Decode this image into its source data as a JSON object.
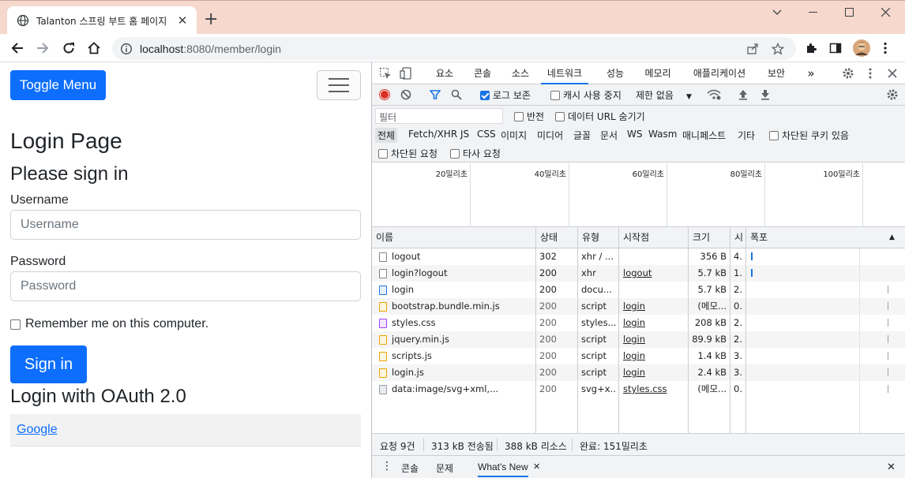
{
  "browser": {
    "tab_title": "Talanton 스프링 부트 홈 페이지",
    "url_host": "localhost",
    "url_rest": ":8080/member/login"
  },
  "page": {
    "toggle_menu": "Toggle Menu",
    "title": "Login Page",
    "subtitle": "Please sign in",
    "username_label": "Username",
    "username_placeholder": "Username",
    "password_label": "Password",
    "password_placeholder": "Password",
    "remember_label": "Remember me on this computer.",
    "signin_label": "Sign in",
    "oauth_heading": "Login with OAuth 2.0",
    "google_link": "Google"
  },
  "devtools": {
    "tabs": [
      "요소",
      "콘솔",
      "소스",
      "네트워크",
      "성능",
      "메모리",
      "애플리케이션",
      "보안"
    ],
    "active_tab": "네트워크",
    "more": "»",
    "toolbar": {
      "preserve_log": "로그 보존",
      "disable_cache": "캐시 사용 중지",
      "throttle": "제한 없음"
    },
    "filter": {
      "placeholder": "필터",
      "invert": "반전",
      "hide_data_urls": "데이터 URL 숨기기",
      "types": [
        "전체",
        "Fetch/XHR",
        "JS",
        "CSS",
        "이미지",
        "미디어",
        "글꼴",
        "문서",
        "WS",
        "Wasm",
        "매니페스트",
        "기타"
      ],
      "blocked_cookies": "차단된 쿠키 있음",
      "blocked_requests": "차단된 요청",
      "third_party": "타사 요청"
    },
    "overview_ticks": [
      "20밀리초",
      "40밀리초",
      "60밀리초",
      "80밀리초",
      "100밀리초"
    ],
    "columns": [
      "이름",
      "상태",
      "유형",
      "시작점",
      "크기",
      "시",
      "폭포"
    ],
    "rows": [
      {
        "name": "logout",
        "status": "302",
        "type": "xhr / ...",
        "initiator": "",
        "size": "356 B",
        "time": "4...",
        "icon": "file"
      },
      {
        "name": "login?logout",
        "status": "200",
        "type": "xhr",
        "initiator": "logout",
        "size": "5.7 kB",
        "time": "1...",
        "icon": "file"
      },
      {
        "name": "login",
        "status": "200",
        "type": "docu...",
        "initiator": "",
        "size": "5.7 kB",
        "time": "2...",
        "icon": "doc"
      },
      {
        "name": "bootstrap.bundle.min.js",
        "status": "200",
        "type": "script",
        "initiator": "login",
        "size": "(메모...",
        "time": "0...",
        "icon": "js"
      },
      {
        "name": "styles.css",
        "status": "200",
        "type": "styles...",
        "initiator": "login",
        "size": "208 kB",
        "time": "2...",
        "icon": "css"
      },
      {
        "name": "jquery.min.js",
        "status": "200",
        "type": "script",
        "initiator": "login",
        "size": "89.9 kB",
        "time": "2...",
        "icon": "js"
      },
      {
        "name": "scripts.js",
        "status": "200",
        "type": "script",
        "initiator": "login",
        "size": "1.4 kB",
        "time": "3...",
        "icon": "js"
      },
      {
        "name": "login.js",
        "status": "200",
        "type": "script",
        "initiator": "login",
        "size": "2.4 kB",
        "time": "3...",
        "icon": "js"
      },
      {
        "name": "data:image/svg+xml,...",
        "status": "200",
        "type": "svg+x...",
        "initiator": "styles.css",
        "size": "(메모...",
        "time": "0...",
        "icon": "img"
      }
    ],
    "status_bar": {
      "requests": "요청 9건",
      "transferred": "313 kB 전송됨",
      "resources": "388 kB 리소스",
      "finish": "완료: 151밀리초"
    },
    "drawer": {
      "tabs": [
        "콘솔",
        "문제",
        "What's New"
      ]
    }
  }
}
